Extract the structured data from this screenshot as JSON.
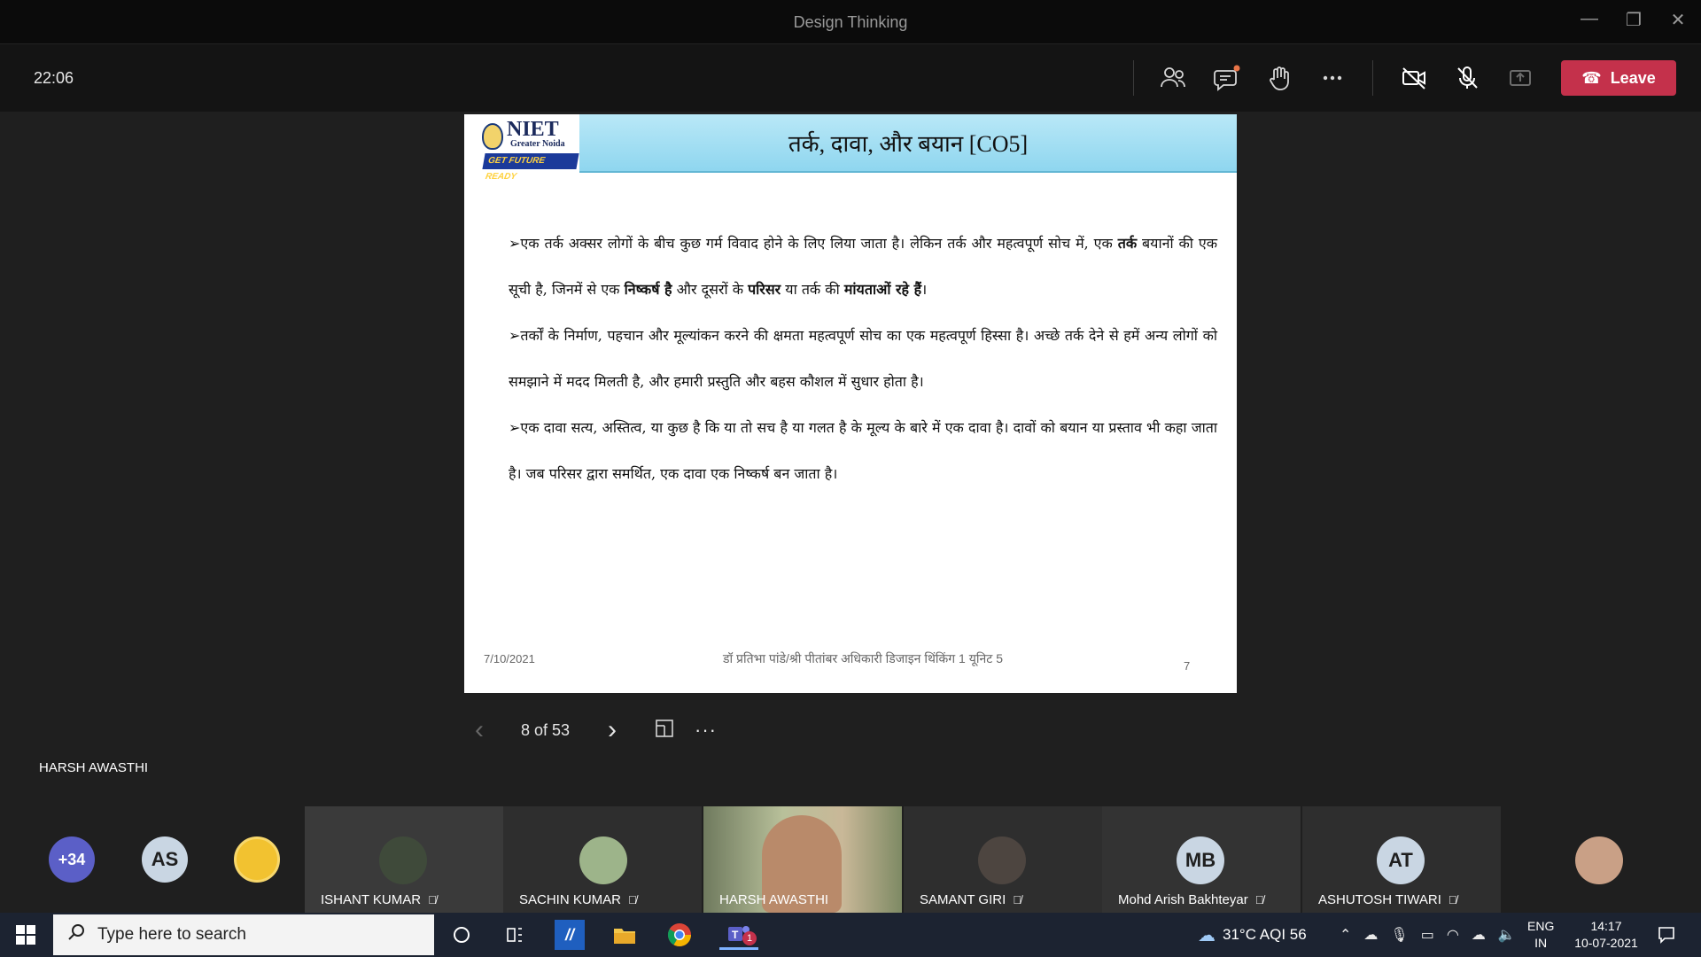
{
  "window": {
    "title": "Design Thinking",
    "minimize": "—",
    "restore": "❐",
    "close": "✕"
  },
  "callbar": {
    "timer": "22:06",
    "leave_label": "Leave",
    "icons": [
      "people-icon",
      "chat-icon",
      "raise-hand-icon",
      "more-icon",
      "camera-off-icon",
      "mic-off-icon",
      "share-tray-icon"
    ]
  },
  "slide": {
    "logo_name": "NIET",
    "logo_sub": "Greater Noida",
    "logo_tag": "GET FUTURE READY",
    "title": "तर्क, दावा, और बयान [CO5]",
    "bullet": "➢",
    "para1_a": "एक तर्क अक्सर लोगों के बीच कुछ गर्म विवाद होने के लिए लिया जाता है। लेकिन तर्क और महत्वपूर्ण सोच में, एक ",
    "para1_b": "तर्क",
    "para1_c": " बयानों की एक सूची है, जिनमें से एक ",
    "para1_d": "निष्कर्ष है",
    "para1_e": " और दूसरों के ",
    "para1_f": "परिसर",
    "para1_g": " या तर्क की ",
    "para1_h": "मांयताओं रहे हैं",
    "para1_i": "।",
    "para2": "तर्कों के निर्माण, पहचान और मूल्यांकन करने की क्षमता महत्वपूर्ण सोच का एक महत्वपूर्ण हिस्सा है। अच्छे तर्क देने से हमें अन्य लोगों को समझाने में मदद मिलती है, और हमारी प्रस्तुति और बहस कौशल में सुधार होता है।",
    "para3": "एक दावा सत्य, अस्तित्व, या कुछ है कि या तो सच है या गलत है के मूल्य के बारे में एक दावा है। दावों को बयान या प्रस्ताव भी कहा जाता है। जब परिसर द्वारा समर्थित, एक दावा एक निष्कर्ष बन जाता है।",
    "footer_date": "7/10/2021",
    "footer_center": "डॉ प्रतिभा पांडे/श्री पीतांबर अधिकारी डिजाइन थिंकिंग 1 यूनिट 5",
    "footer_page": "7"
  },
  "pager": {
    "label": "8 of 53",
    "prev": "‹",
    "next": "›",
    "more": "···"
  },
  "presenter": "HARSH AWASTHI",
  "participants": {
    "overflow": "+34",
    "as_initials": "AS",
    "tiles": [
      {
        "name": "ISHANT KUMAR"
      },
      {
        "name": "SACHIN KUMAR"
      },
      {
        "name": "HARSH AWASTHI"
      },
      {
        "name": "SAMANT GIRI"
      },
      {
        "name": "Mohd Arish Bakhteyar",
        "initials": "MB"
      },
      {
        "name": "ASHUTOSH TIWARI",
        "initials": "AT"
      }
    ]
  },
  "taskbar": {
    "search_placeholder": "Type here to search",
    "weather": "31°C  AQI 56",
    "lang_top": "ENG",
    "lang_bottom": "IN",
    "time": "14:17",
    "date": "10-07-2021",
    "teams_badge": "1"
  },
  "colors": {
    "leave": "#c4314b",
    "avatar_overflow": "#5b5fc7",
    "avatar_light": "#c9d6e3"
  }
}
